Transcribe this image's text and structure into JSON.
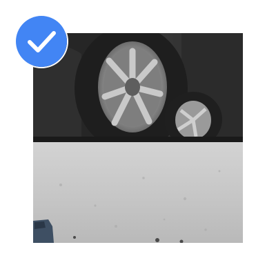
{
  "tile": {
    "selected": true,
    "photo_alt": "",
    "check_icon": "check-circle-icon",
    "colors": {
      "accent": "#4285f4",
      "check": "#ffffff",
      "background": "#ffffff"
    }
  }
}
